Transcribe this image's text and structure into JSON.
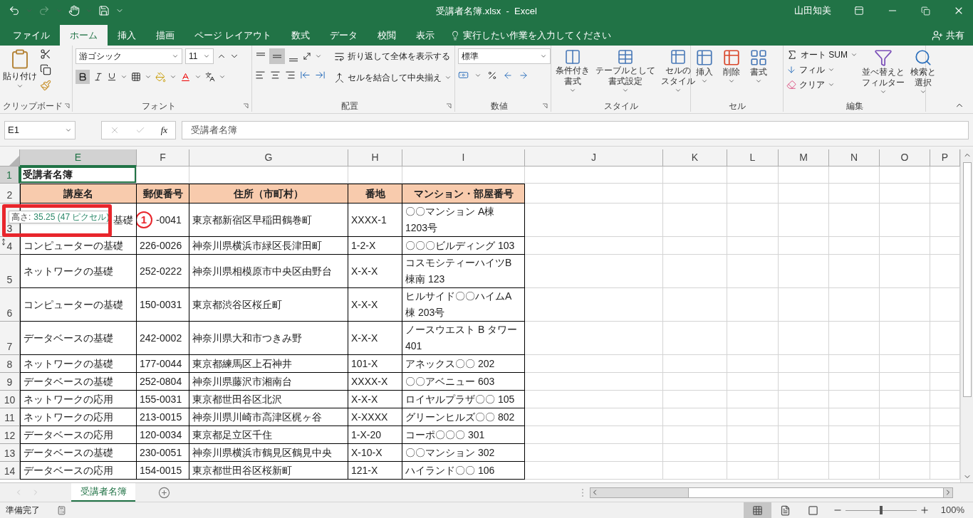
{
  "window": {
    "title": "受講者名簿.xlsx  -  Excel",
    "user": "山田知美"
  },
  "menu_tabs": [
    {
      "label": "ファイル",
      "selected": false
    },
    {
      "label": "ホーム",
      "selected": true
    },
    {
      "label": "挿入",
      "selected": false
    },
    {
      "label": "描画",
      "selected": false
    },
    {
      "label": "ページ レイアウト",
      "selected": false
    },
    {
      "label": "数式",
      "selected": false
    },
    {
      "label": "データ",
      "selected": false
    },
    {
      "label": "校閲",
      "selected": false
    },
    {
      "label": "表示",
      "selected": false
    }
  ],
  "tell_me": {
    "placeholder": "実行したい作業を入力してください"
  },
  "share": "共有",
  "ribbon": {
    "clipboard": {
      "paste": "貼り付け",
      "label": "クリップボード"
    },
    "font": {
      "name": "游ゴシック",
      "size": "11",
      "bold": true,
      "label": "フォント"
    },
    "alignment": {
      "middle_align": true,
      "wrap": "折り返して全体を表示する",
      "merge": "セルを結合して中央揃え",
      "label": "配置"
    },
    "number": {
      "format": "標準",
      "label": "数値"
    },
    "styles": {
      "items": [
        [
          "条件付き",
          "書式"
        ],
        [
          "テーブルとして",
          "書式設定"
        ],
        [
          "セルの",
          "スタイル"
        ]
      ],
      "label": "スタイル"
    },
    "cells": {
      "items": [
        "挿入",
        "削除",
        "書式"
      ],
      "label": "セル"
    },
    "editing": {
      "autosum": "オート SUM",
      "fill": "フィル",
      "clear": "クリア",
      "sort": [
        "並べ替えと",
        "フィルター"
      ],
      "find": [
        "検索と",
        "選択"
      ],
      "label": "編集"
    }
  },
  "formula_bar": {
    "name_box": "E1",
    "function_label": "fx",
    "value": "受講者名簿"
  },
  "columns": [
    {
      "label": "E",
      "selected": true
    },
    {
      "label": "F",
      "selected": false
    },
    {
      "label": "G",
      "selected": false
    },
    {
      "label": "H",
      "selected": false
    },
    {
      "label": "I",
      "selected": false
    },
    {
      "label": "J",
      "selected": false
    },
    {
      "label": "K",
      "selected": false
    },
    {
      "label": "L",
      "selected": false
    },
    {
      "label": "M",
      "selected": false
    },
    {
      "label": "N",
      "selected": false
    },
    {
      "label": "O",
      "selected": false
    },
    {
      "label": "P",
      "selected": false
    }
  ],
  "rows": [
    {
      "number": "1",
      "kind": "title",
      "selected": true,
      "e": "受講者名簿"
    },
    {
      "number": "2",
      "kind": "header",
      "selected": false,
      "e": "講座名",
      "f": "郵便番号",
      "g": "住所（市町村）",
      "h": "番地",
      "i": "マンション・部屋番号"
    },
    {
      "number": "3",
      "kind": "data",
      "selected": false,
      "e": "基礎",
      "marker": "1",
      "f": "-0041",
      "g": "東京都新宿区早稲田鶴巻町",
      "h": "XXXX-1",
      "i": "〇〇マンション A棟\n1203号"
    },
    {
      "number": "4",
      "kind": "data",
      "selected": false,
      "e": "コンピューターの基礎",
      "f": "226-0026",
      "g": "神奈川県横浜市緑区長津田町",
      "h": "1-2-X",
      "i": "〇〇〇ビルディング 103"
    },
    {
      "number": "5",
      "kind": "data",
      "selected": false,
      "e": "ネットワークの基礎",
      "f": "252-0222",
      "g": "神奈川県相模原市中央区由野台",
      "h": "X-X-X",
      "i": "コスモシティーハイツB\n棟南 123"
    },
    {
      "number": "6",
      "kind": "data",
      "selected": false,
      "e": "コンピューターの基礎",
      "f": "150-0031",
      "g": "東京都渋谷区桜丘町",
      "h": "X-X-X",
      "i": "ヒルサイド〇〇ハイムA\n棟 203号"
    },
    {
      "number": "7",
      "kind": "data",
      "selected": false,
      "e": "データベースの基礎",
      "f": "242-0002",
      "g": "神奈川県大和市つきみ野",
      "h": "X-X-X",
      "i": "ノースウエスト B タワー\n401"
    },
    {
      "number": "8",
      "kind": "data",
      "selected": false,
      "e": "ネットワークの基礎",
      "f": "177-0044",
      "g": "東京都練馬区上石神井",
      "h": "101-X",
      "i": "アネックス〇〇 202"
    },
    {
      "number": "9",
      "kind": "data",
      "selected": false,
      "e": "データベースの基礎",
      "f": "252-0804",
      "g": "神奈川県藤沢市湘南台",
      "h": "XXXX-X",
      "i": "〇〇アベニュー 603"
    },
    {
      "number": "10",
      "kind": "data",
      "selected": false,
      "e": "ネットワークの応用",
      "f": "155-0031",
      "g": "東京都世田谷区北沢",
      "h": "X-X-X",
      "i": "ロイヤルプラザ〇〇 105"
    },
    {
      "number": "11",
      "kind": "data",
      "selected": false,
      "e": "ネットワークの応用",
      "f": "213-0015",
      "g": "神奈川県川崎市高津区梶ヶ谷",
      "h": "X-XXXX",
      "i": "グリーンヒルズ〇〇 802"
    },
    {
      "number": "12",
      "kind": "data",
      "selected": false,
      "e": "データベースの応用",
      "f": "120-0034",
      "g": "東京都足立区千住",
      "h": "1-X-20",
      "i": "コーポ〇〇〇 301"
    },
    {
      "number": "13",
      "kind": "data",
      "selected": false,
      "e": "データベースの基礎",
      "f": "230-0051",
      "g": "神奈川県横浜市鶴見区鶴見中央",
      "h": "X-10-X",
      "i": "〇〇マンション 302"
    },
    {
      "number": "14",
      "kind": "data",
      "selected": false,
      "e": "データベースの応用",
      "f": "154-0015",
      "g": "東京都世田谷区桜新町",
      "h": "121-X",
      "i": "ハイランド〇〇 106"
    }
  ],
  "annotations": {
    "tooltip_label": "高さ:",
    "tooltip_value": "35.25 (47 ピクセル)"
  },
  "sheets": [
    {
      "label": "受講者名簿",
      "selected": true
    }
  ],
  "status_bar": {
    "text": "準備完了",
    "views": [
      {
        "kind": "normal",
        "selected": true
      },
      {
        "kind": "page_layout",
        "selected": false
      },
      {
        "kind": "page_break",
        "selected": false
      }
    ],
    "zoom": {
      "level": 0.5
    },
    "zoom_text": "100%"
  }
}
